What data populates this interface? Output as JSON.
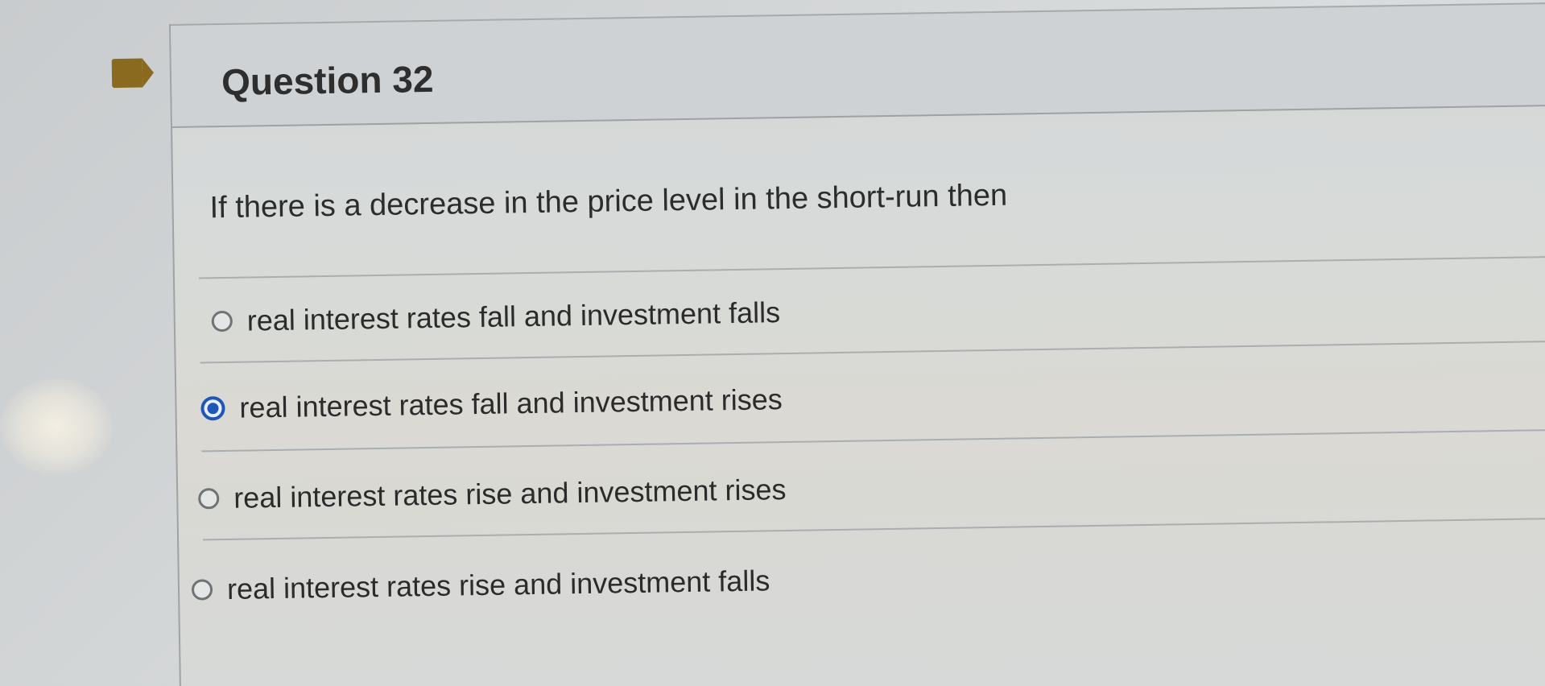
{
  "question": {
    "title": "Question 32",
    "prompt": "If there is a decrease in the price level in the short-run then",
    "flag_icon": "flag-icon",
    "flag_color": "#8a6a1e"
  },
  "options": [
    {
      "label": "real interest rates fall and investment falls",
      "selected": false
    },
    {
      "label": "real interest rates fall and investment rises",
      "selected": true
    },
    {
      "label": "real interest rates rise and investment rises",
      "selected": false
    },
    {
      "label": "real interest rates rise and investment falls",
      "selected": false
    }
  ],
  "colors": {
    "radio_selected": "#1f56b8",
    "radio_unselected": "#6f7376"
  }
}
